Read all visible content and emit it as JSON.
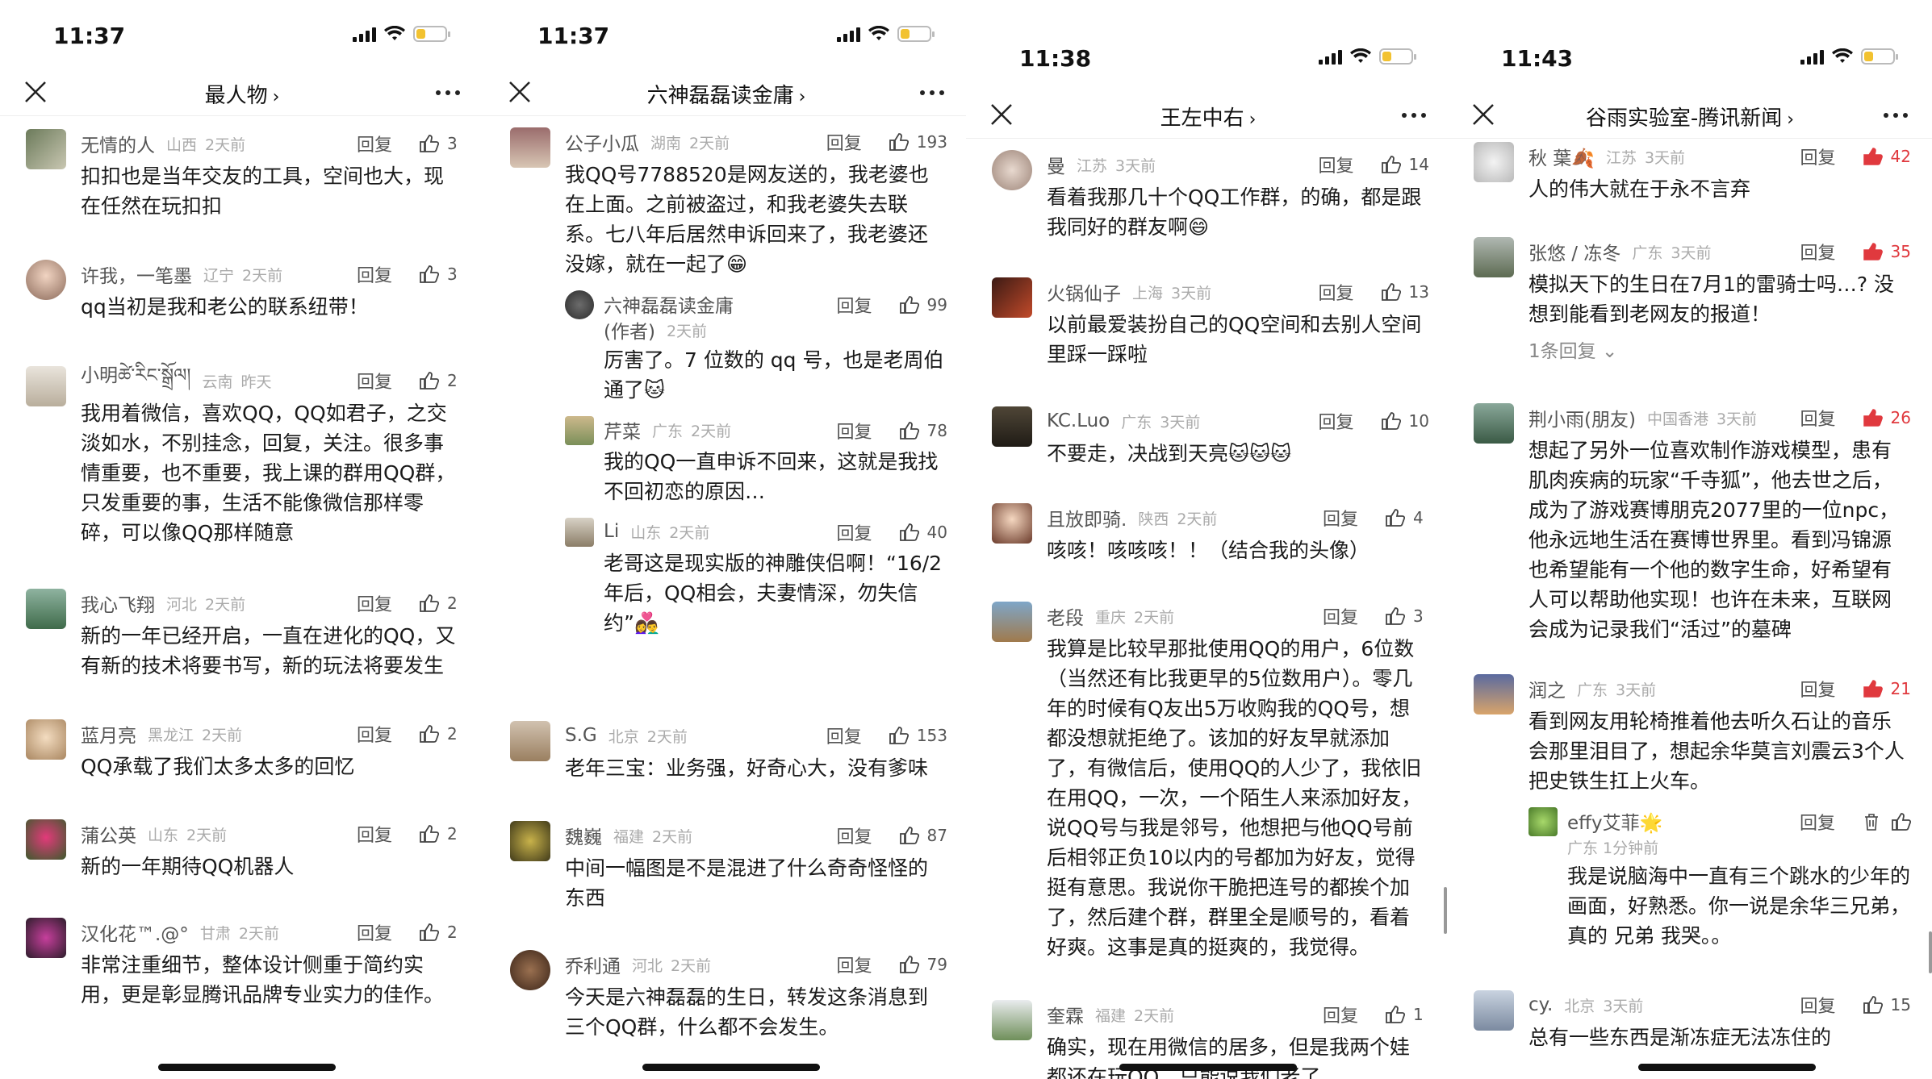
{
  "panels": [
    {
      "time": "11:37",
      "title": "最人物",
      "comments": [
        {
          "name": "无情的人",
          "loc": "山西",
          "ago": "2天前",
          "likes": "3",
          "text": "扣扣也是当年交友的工具，空间也大，现在任然在玩扣扣"
        },
        {
          "name": "许我，一笔墨",
          "loc": "辽宁",
          "ago": "2天前",
          "likes": "3",
          "text": "qq当初是我和老公的联系纽带！"
        },
        {
          "name": "小明ཚེ་རིང་སྒྲོལ།",
          "loc": "云南",
          "ago": "昨天",
          "likes": "2",
          "text": "我用着微信，喜欢QQ，QQ如君子，之交淡如水，不别挂念，回复，关注。很多事情重要，也不重要，我上课的群用QQ群，只发重要的事，生活不能像微信那样零碎，可以像QQ那样随意"
        },
        {
          "name": "我心飞翔",
          "loc": "河北",
          "ago": "2天前",
          "likes": "2",
          "text": "新的一年已经开启，一直在进化的QQ，又有新的技术将要书写，新的玩法将要发生"
        },
        {
          "name": "蓝月亮",
          "loc": "黑龙江",
          "ago": "2天前",
          "likes": "2",
          "text": "QQ承载了我们太多太多的回忆"
        },
        {
          "name": "蒲公英",
          "loc": "山东",
          "ago": "2天前",
          "likes": "2",
          "text": "新的一年期待QQ机器人"
        },
        {
          "name": "汉化花™.@°",
          "loc": "甘肃",
          "ago": "2天前",
          "likes": "2",
          "text": "非常注重细节，整体设计侧重于简约实用，更是彰显腾讯品牌专业实力的佳作。"
        }
      ]
    },
    {
      "time": "11:37",
      "title": "六神磊磊读金庸",
      "comments": [
        {
          "name": "公子小瓜",
          "loc": "湖南",
          "ago": "2天前",
          "likes": "193",
          "text": "我QQ号7788520是网友送的，我老婆也在上面。之前被盗过，和我老婆失去联系。七八年后居然申诉回来了，我老婆还没嫁，就在一起了😁",
          "subs": [
            {
              "name": "六神磊磊读金庸",
              "tag": "(作者)",
              "ago": "2天前",
              "likes": "99",
              "text": "厉害了。7 位数的 qq 号，也是老周伯通了🐱"
            },
            {
              "name": "芹菜",
              "loc": "广东",
              "ago": "2天前",
              "likes": "78",
              "text": "我的QQ一直申诉不回来，这就是我找不回初恋的原因…"
            },
            {
              "name": "Li",
              "loc": "山东",
              "ago": "2天前",
              "likes": "40",
              "text": "老哥这是现实版的神雕侠侣啊！“16/2年后，QQ相会，夫妻情深，勿失信约”👩‍❤️‍👨"
            }
          ]
        },
        {
          "name": "S.G",
          "loc": "北京",
          "ago": "2天前",
          "likes": "153",
          "text": "老年三宝：业务强，好奇心大，没有爹味"
        },
        {
          "name": "魏巍",
          "loc": "福建",
          "ago": "2天前",
          "likes": "87",
          "text": "中间一幅图是不是混进了什么奇奇怪怪的东西"
        },
        {
          "name": "乔利通",
          "loc": "河北",
          "ago": "2天前",
          "likes": "79",
          "text": "今天是六神磊磊的生日，转发这条消息到三个QQ群，什么都不会发生。"
        }
      ]
    },
    {
      "time": "11:38",
      "title": "王左中右",
      "comments": [
        {
          "name": "曼",
          "loc": "江苏",
          "ago": "3天前",
          "likes": "14",
          "text": "看着我那几十个QQ工作群，的确，都是跟我同好的群友啊😄"
        },
        {
          "name": "火锅仙子",
          "loc": "上海",
          "ago": "3天前",
          "likes": "13",
          "text": "以前最爱装扮自己的QQ空间和去别人空间里踩一踩啦"
        },
        {
          "name": "KC.Luo",
          "loc": "广东",
          "ago": "3天前",
          "likes": "10",
          "text": "不要走，决战到天亮🐱🐱🐱"
        },
        {
          "name": "且放即骑.",
          "loc": "陕西",
          "ago": "2天前",
          "likes": "4",
          "text": "咳咳！咳咳咳！！（结合我的头像）"
        },
        {
          "name": "老段",
          "loc": "重庆",
          "ago": "2天前",
          "likes": "3",
          "text": "我算是比较早那批使用QQ的用户，6位数（当然还有比我更早的5位数用户）。零几年的时候有Q友出5万收购我的QQ号，想都没想就拒绝了。该加的好友早就添加了，有微信后，使用QQ的人少了，我依旧在用QQ，一次，一个陌生人来添加好友，说QQ号与我是邻号，他想把与他QQ号前后相邻正负10以内的号都加为好友，觉得挺有意思。我说你干脆把连号的都挨个加了，然后建个群，群里全是顺号的，看着好爽。这事是真的挺爽的，我觉得。"
        },
        {
          "name": "奎霖",
          "loc": "福建",
          "ago": "2天前",
          "likes": "1",
          "text": "确实，现在用微信的居多，但是我两个娃都还在玩QQ，只能说我们老了"
        }
      ]
    },
    {
      "time": "11:43",
      "title": "谷雨实验室-腾讯新闻",
      "comments": [
        {
          "name": "秋 葉🍂",
          "loc": "江苏",
          "ago": "3天前",
          "likes": "42",
          "red": true,
          "text": "人的伟大就在于永不言弃"
        },
        {
          "name": "张悠 / 冻冬",
          "loc": "广东",
          "ago": "3天前",
          "likes": "35",
          "red": true,
          "text": "模拟天下的生日在7月1的雷骑士吗…? 没想到能看到老网友的报道！",
          "more": "1条回复 ⌄"
        },
        {
          "name": "荆小雨(朋友)",
          "loc": "中国香港",
          "ago": "3天前",
          "likes": "26",
          "red": true,
          "text": "想起了另外一位喜欢制作游戏模型，患有肌肉疾病的玩家“千寺狐”，他去世之后，成为了游戏赛博朋克2077里的一位npc，他永远地生活在赛博世界里。看到冯锦源也希望能有一个他的数字生命，好希望有人可以帮助他实现！也许在未来，互联网会成为记录我们“活过”的墓碑"
        },
        {
          "name": "润之",
          "loc": "广东",
          "ago": "3天前",
          "likes": "21",
          "red": true,
          "text": "看到网友用轮椅推着他去听久石让的音乐会那里泪目了，想起余华莫言刘震云3个人把史铁生扛上火车。",
          "subs": [
            {
              "name": "effy艾菲🌟",
              "loc2": "广东 1分钟前",
              "likes": "",
              "text": "我是说脑海中一直有三个跳水的少年的画面，好熟悉。你一说是余华三兄弟，真的 兄弟 我哭。。"
            }
          ]
        },
        {
          "name": "cy.",
          "loc": "北京",
          "ago": "3天前",
          "likes": "15",
          "text": "总有一些东西是渐冻症无法冻住的"
        }
      ]
    }
  ],
  "labels": {
    "reply": "回复"
  },
  "colors": {
    "like_red": "#e0393e",
    "meta_gray": "#aaaaaa",
    "battery": "#f2c230"
  }
}
